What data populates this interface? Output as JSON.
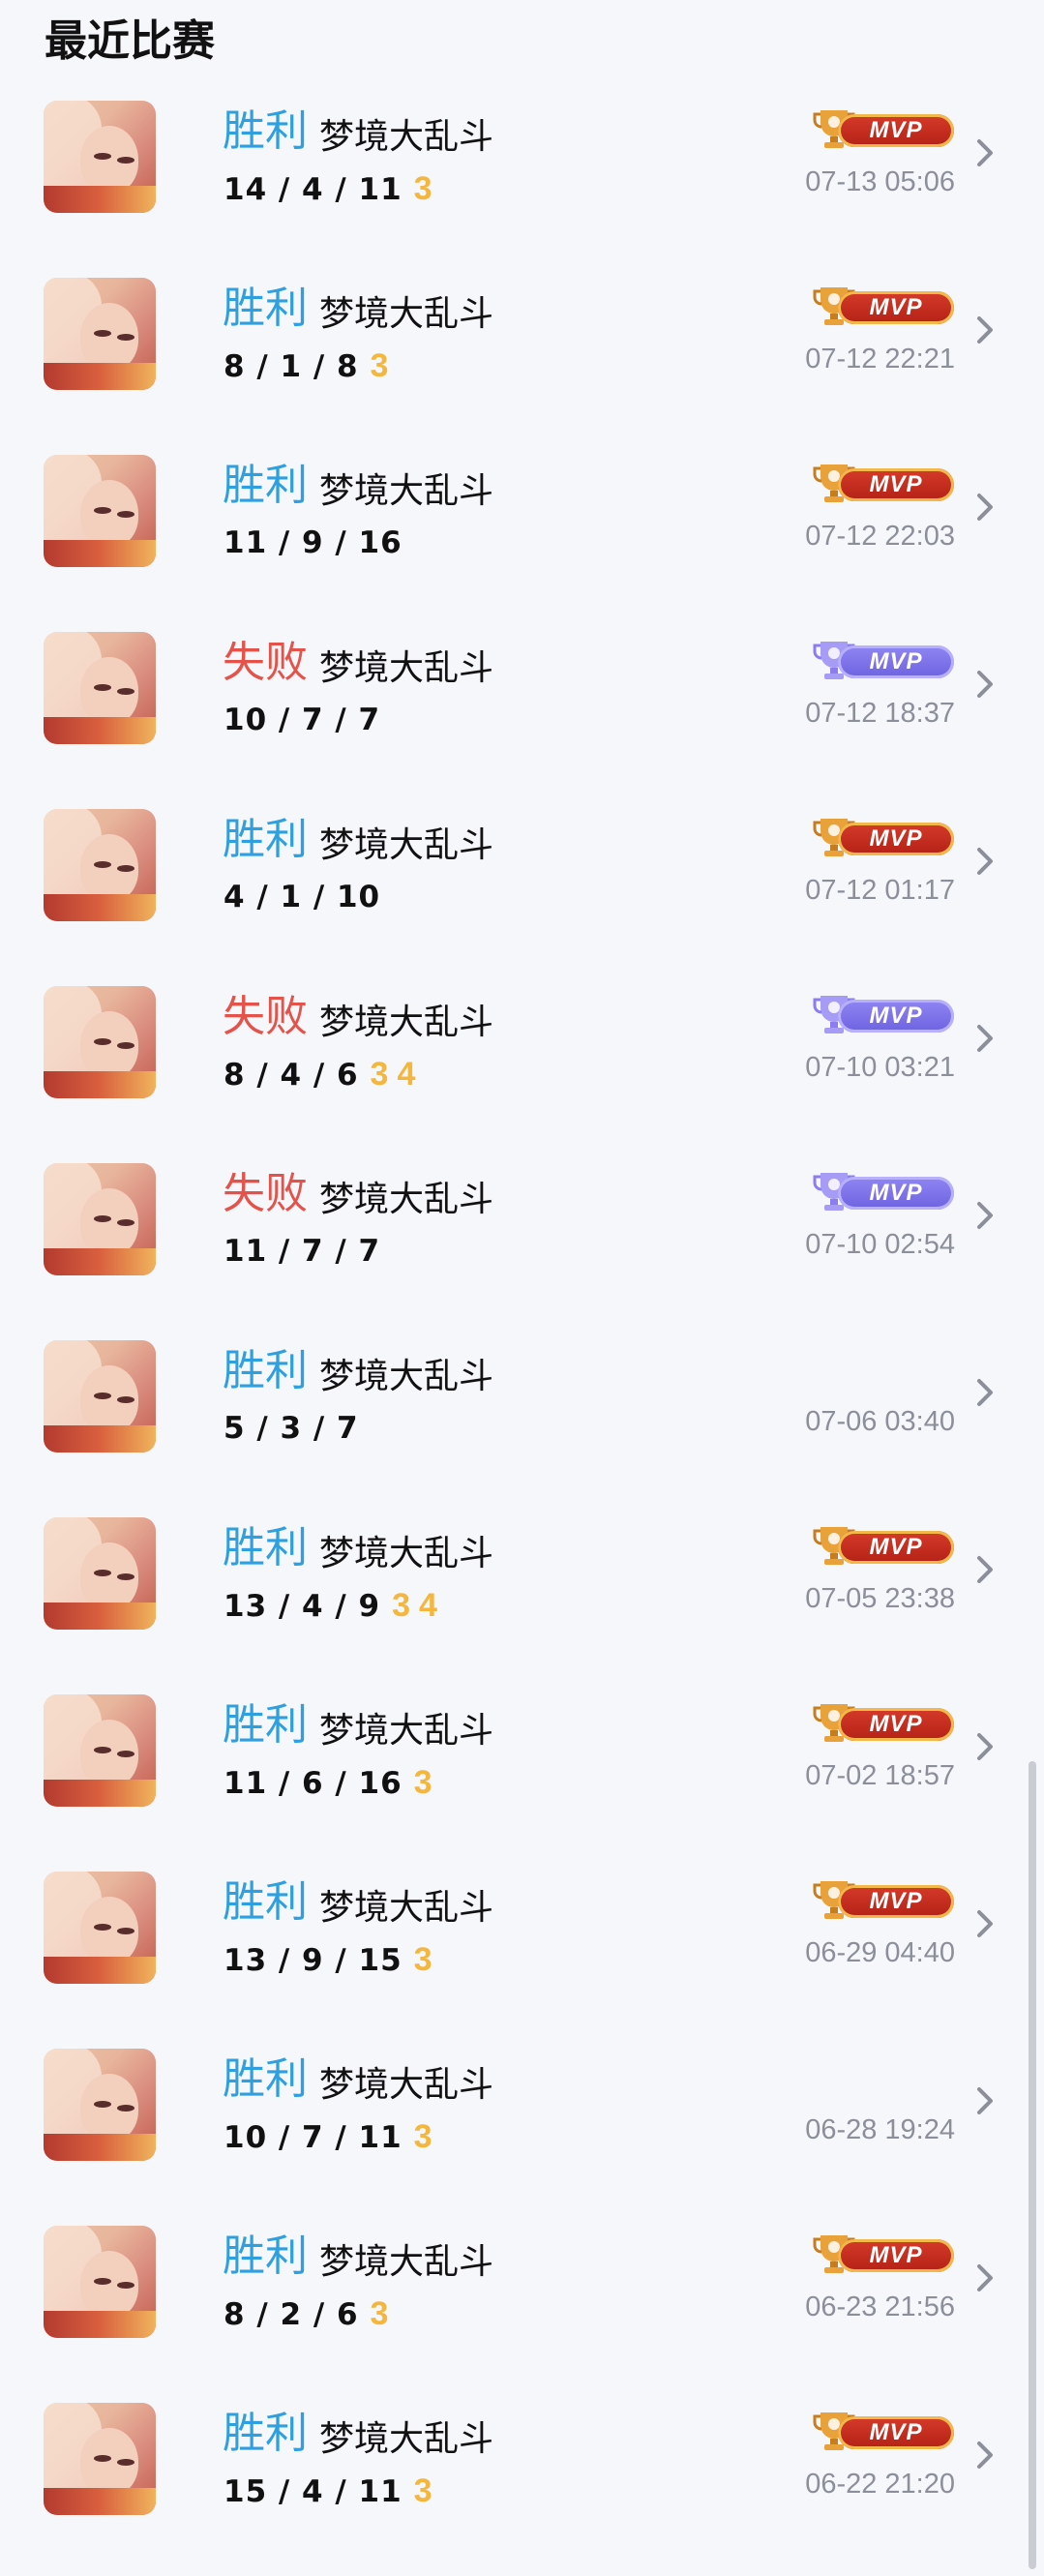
{
  "header": {
    "title": "最近比赛"
  },
  "mvp_label": "MVP",
  "colors": {
    "win": "#2ea0e0",
    "lose": "#e5524a",
    "badge": "#f4b63c",
    "mvp_gold": "#c2261a",
    "mvp_purple": "#7b70ea"
  },
  "matches": [
    {
      "result": "胜利",
      "outcome": "win",
      "mode": "梦境大乱斗",
      "kda": "14 / 4 / 11",
      "badges": [
        "3"
      ],
      "mvp": "gold",
      "time": "07-13 05:06"
    },
    {
      "result": "胜利",
      "outcome": "win",
      "mode": "梦境大乱斗",
      "kda": "8 / 1 / 8",
      "badges": [
        "3"
      ],
      "mvp": "gold",
      "time": "07-12 22:21"
    },
    {
      "result": "胜利",
      "outcome": "win",
      "mode": "梦境大乱斗",
      "kda": "11 / 9 / 16",
      "badges": [],
      "mvp": "gold",
      "time": "07-12 22:03"
    },
    {
      "result": "失败",
      "outcome": "lose",
      "mode": "梦境大乱斗",
      "kda": "10 / 7 / 7",
      "badges": [],
      "mvp": "purple",
      "time": "07-12 18:37"
    },
    {
      "result": "胜利",
      "outcome": "win",
      "mode": "梦境大乱斗",
      "kda": "4 / 1 / 10",
      "badges": [],
      "mvp": "gold",
      "time": "07-12 01:17"
    },
    {
      "result": "失败",
      "outcome": "lose",
      "mode": "梦境大乱斗",
      "kda": "8 / 4 / 6",
      "badges": [
        "3",
        "4"
      ],
      "mvp": "purple",
      "time": "07-10 03:21"
    },
    {
      "result": "失败",
      "outcome": "lose",
      "mode": "梦境大乱斗",
      "kda": "11 / 7 / 7",
      "badges": [],
      "mvp": "purple",
      "time": "07-10 02:54"
    },
    {
      "result": "胜利",
      "outcome": "win",
      "mode": "梦境大乱斗",
      "kda": "5 / 3 / 7",
      "badges": [],
      "mvp": "none",
      "time": "07-06 03:40"
    },
    {
      "result": "胜利",
      "outcome": "win",
      "mode": "梦境大乱斗",
      "kda": "13 / 4 / 9",
      "badges": [
        "3",
        "4"
      ],
      "mvp": "gold",
      "time": "07-05 23:38"
    },
    {
      "result": "胜利",
      "outcome": "win",
      "mode": "梦境大乱斗",
      "kda": "11 / 6 / 16",
      "badges": [
        "3"
      ],
      "mvp": "gold",
      "time": "07-02 18:57"
    },
    {
      "result": "胜利",
      "outcome": "win",
      "mode": "梦境大乱斗",
      "kda": "13 / 9 / 15",
      "badges": [
        "3"
      ],
      "mvp": "gold",
      "time": "06-29 04:40"
    },
    {
      "result": "胜利",
      "outcome": "win",
      "mode": "梦境大乱斗",
      "kda": "10 / 7 / 11",
      "badges": [
        "3"
      ],
      "mvp": "none",
      "time": "06-28 19:24"
    },
    {
      "result": "胜利",
      "outcome": "win",
      "mode": "梦境大乱斗",
      "kda": "8 / 2 / 6",
      "badges": [
        "3"
      ],
      "mvp": "gold",
      "time": "06-23 21:56"
    },
    {
      "result": "胜利",
      "outcome": "win",
      "mode": "梦境大乱斗",
      "kda": "15 / 4 / 11",
      "badges": [
        "3"
      ],
      "mvp": "gold",
      "time": "06-22 21:20"
    }
  ]
}
